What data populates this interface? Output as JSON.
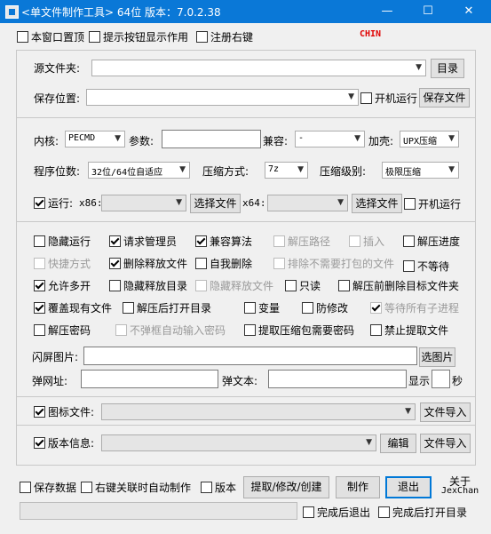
{
  "window": {
    "title": "<单文件制作工具> 64位 版本：7.0.2.38",
    "minimize": "—",
    "maximize": "☐",
    "close": "✕"
  },
  "top": {
    "stay_on_top": "本窗口置顶",
    "show_tips": "提示按钮显示作用",
    "register_menu": "注册右键",
    "chin": "CHIN"
  },
  "source": {
    "label": "源文件夹:",
    "dir_button": "目录"
  },
  "save": {
    "label": "保存位置:",
    "autorun": "开机运行",
    "save_button": "保存文件"
  },
  "kernel": {
    "label": "内核:",
    "value": "PECMD",
    "params_label": "参数:",
    "compat_label": "兼容:",
    "compat_value": "-",
    "shell_label": "加壳:",
    "shell_value": "UPX压缩"
  },
  "program": {
    "bits_label": "程序位数:",
    "bits_value": "32位/64位自适应",
    "method_label": "压缩方式:",
    "method_value": "7z",
    "level_label": "压缩级别:",
    "level_value": "极限压缩"
  },
  "run": {
    "label": "运行:",
    "x86": "x86:",
    "select1": "选择文件",
    "x64": "x64:",
    "select2": "选择文件",
    "autorun": "开机运行"
  },
  "options": {
    "row1": [
      "隐藏运行",
      "请求管理员",
      "兼容算法",
      "解压路径",
      "插入",
      "解压进度"
    ],
    "row2": [
      "快捷方式",
      "删除释放文件",
      "自我删除",
      "排除不需要打包的文件",
      "不等待"
    ],
    "row3": [
      "允许多开",
      "隐藏释放目录",
      "隐藏释放文件",
      "只读",
      "解压前删除目标文件夹"
    ],
    "row4": [
      "覆盖现有文件",
      "解压后打开目录",
      "变量",
      "防修改",
      "等待所有子进程"
    ],
    "row5": [
      "解压密码",
      "不弹框自动输入密码",
      "提取压缩包需要密码",
      "禁止提取文件"
    ]
  },
  "splash": {
    "label": "闪屏图片:",
    "button": "选图片"
  },
  "popup": {
    "url_label": "弹网址:",
    "text_label": "弹文本:",
    "show_label": "显示",
    "seconds_label": "秒"
  },
  "icon": {
    "label": "图标文件:",
    "button": "文件导入"
  },
  "version": {
    "label": "版本信息:",
    "edit_button": "编辑",
    "import_button": "文件导入"
  },
  "bottom": {
    "save_data": "保存数据",
    "auto_make": "右键关联时自动制作",
    "version": "版本",
    "extract_button": "提取/修改/创建",
    "make_button": "制作",
    "exit_button": "退出",
    "about_line1": "关于",
    "about_line2": "JexChan",
    "exit_after": "完成后退出",
    "open_after": "完成后打开目录"
  }
}
